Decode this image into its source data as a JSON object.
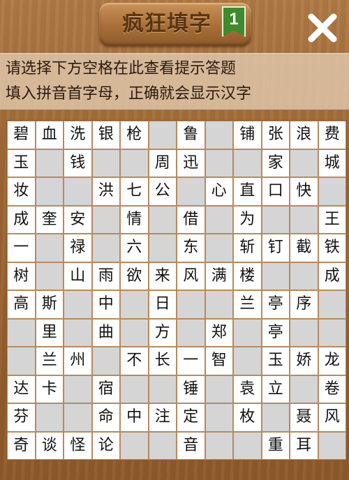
{
  "header": {
    "title": "疯狂填字",
    "level": "1"
  },
  "hints": {
    "line1": "请选择下方空格在此查看提示答题",
    "line2": "填入拼音首字母，正确就会显示汉字"
  },
  "colors": {
    "filled_cell": "#ffffff",
    "blocked_cell": "#d5d5d5",
    "grid_line": "#b78a5c",
    "level_badge": "#3f8a2c"
  },
  "board": {
    "rows": [
      [
        "碧",
        "血",
        "洗",
        "银",
        "枪",
        null,
        "鲁",
        null,
        "铺",
        "张",
        "浪",
        "费"
      ],
      [
        "玉",
        null,
        "钱",
        null,
        null,
        "周",
        "迅",
        null,
        null,
        "家",
        null,
        "城"
      ],
      [
        "妆",
        null,
        null,
        "洪",
        "七",
        "公",
        null,
        "心",
        "直",
        "口",
        "快",
        null
      ],
      [
        "成",
        "奎",
        "安",
        null,
        "情",
        null,
        "借",
        null,
        "为",
        null,
        null,
        "王"
      ],
      [
        "一",
        null,
        "禄",
        null,
        "六",
        null,
        "东",
        null,
        "斩",
        "钉",
        "截",
        "铁"
      ],
      [
        "树",
        null,
        "山",
        "雨",
        "欲",
        "来",
        "风",
        "满",
        "楼",
        null,
        null,
        "成"
      ],
      [
        "高",
        "斯",
        null,
        "中",
        null,
        "日",
        null,
        null,
        "兰",
        "亭",
        "序",
        null
      ],
      [
        null,
        "里",
        null,
        "曲",
        null,
        "方",
        null,
        "郑",
        null,
        "亭",
        null,
        null
      ],
      [
        null,
        "兰",
        "州",
        null,
        "不",
        "长",
        "一",
        "智",
        null,
        "玉",
        "娇",
        "龙"
      ],
      [
        "达",
        "卡",
        null,
        "宿",
        null,
        null,
        "锤",
        null,
        "袁",
        "立",
        null,
        "卷"
      ],
      [
        "芬",
        null,
        null,
        "命",
        "中",
        "注",
        "定",
        null,
        "枚",
        null,
        "聂",
        "风"
      ],
      [
        "奇",
        "谈",
        "怪",
        "论",
        null,
        null,
        "音",
        null,
        null,
        "重",
        "耳",
        null
      ]
    ]
  }
}
